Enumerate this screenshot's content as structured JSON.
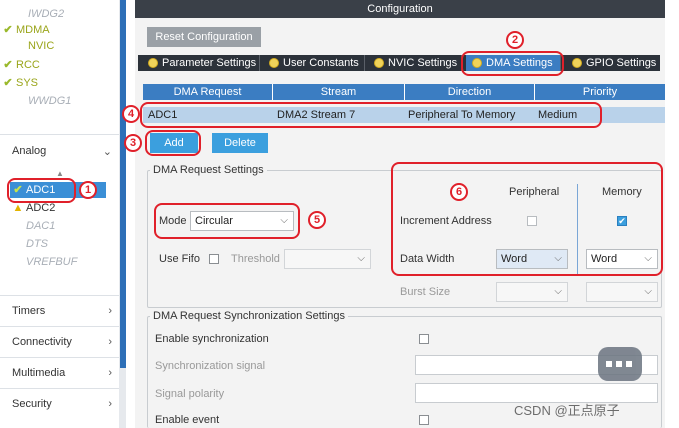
{
  "sidebar": {
    "peripherals": [
      {
        "label": "IWDG2",
        "state": "dim",
        "check": false
      },
      {
        "label": "MDMA",
        "state": "ylw",
        "check": true
      },
      {
        "label": "NVIC",
        "state": "ylw",
        "check": false
      },
      {
        "label": "RCC",
        "state": "ylw",
        "check": true
      },
      {
        "label": "SYS",
        "state": "ylw",
        "check": true
      },
      {
        "label": "WWDG1",
        "state": "dim",
        "check": false
      }
    ],
    "analog_label": "Analog",
    "analog_items": [
      {
        "label": "ADC1"
      },
      {
        "label": "ADC2"
      },
      {
        "label": "DAC1"
      },
      {
        "label": "DTS"
      },
      {
        "label": "VREFBUF"
      }
    ],
    "categories": [
      "Timers",
      "Connectivity",
      "Multimedia",
      "Security"
    ]
  },
  "config": {
    "title": "Configuration",
    "reset_label": "Reset Configuration",
    "tabs": [
      "Parameter Settings",
      "User Constants",
      "NVIC Settings",
      "DMA Settings",
      "GPIO Settings"
    ],
    "active_tab": "DMA Settings"
  },
  "dma_table": {
    "headers": [
      "DMA Request",
      "Stream",
      "Direction",
      "Priority"
    ],
    "row": [
      "ADC1",
      "DMA2 Stream 7",
      "Peripheral To Memory",
      "Medium"
    ],
    "add_label": "Add",
    "delete_label": "Delete"
  },
  "request_settings": {
    "title": "DMA Request Settings",
    "mode_label": "Mode",
    "mode_value": "Circular",
    "use_fifo_label": "Use Fifo",
    "threshold_label": "Threshold",
    "peripheral_label": "Peripheral",
    "memory_label": "Memory",
    "increment_label": "Increment Address",
    "data_width_label": "Data Width",
    "peripheral_width": "Word",
    "memory_width": "Word",
    "burst_label": "Burst Size"
  },
  "sync_settings": {
    "title": "DMA Request Synchronization Settings",
    "enable_sync_label": "Enable synchronization",
    "sync_signal_label": "Synchronization signal",
    "signal_polarity_label": "Signal polarity",
    "enable_event_label": "Enable event"
  },
  "annotations": [
    "1",
    "2",
    "3",
    "4",
    "5",
    "6"
  ],
  "watermark": "CSDN @正点原子",
  "colors": {
    "accent": "#3b7dc2",
    "annotation": "#e0202a",
    "check": "#9ab92b"
  }
}
